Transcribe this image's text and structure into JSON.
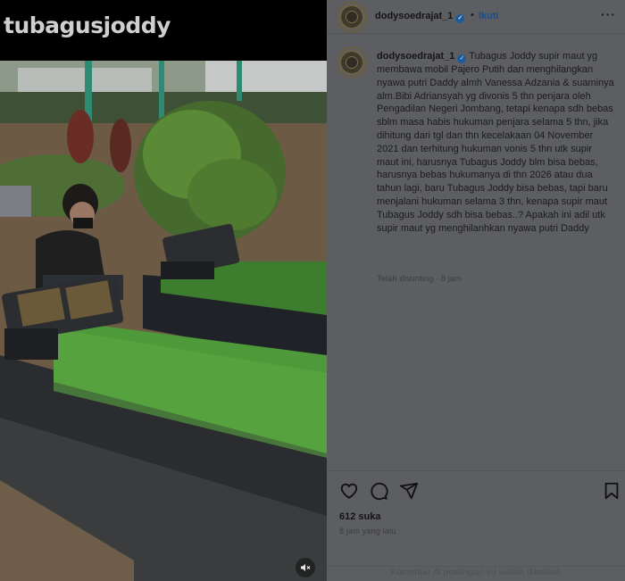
{
  "media": {
    "overlay_text": "tubagusjoddy",
    "mute_icon": "speaker-muted-icon"
  },
  "post": {
    "username": "dodysoedrajat_1",
    "verified_icon": "verified-badge-icon",
    "separator": "•",
    "follow_label": "Ikuti",
    "more_icon": "more-options-icon",
    "caption": "Tubagus Joddy supir maut yg membawa mobil Pajero Putih dan menghilangkan nyawa putri Daddy almh Vanessa Adzania & suaminya alm.Bibi Adriansyah yg divonis 5 thn penjara oleh Pengadilan Negeri Jombang, tetapi kenapa sdh bebas sblm masa habis hukuman penjara selama 5 thn, jika dihitung dari tgl dan thn kecelakaan 04 November 2021 dan terhitung hukuman vonis 5 thn utk supir maut ini, harusnya Tubagus Joddy blm bisa bebas, harusnya bebas hukumanya di thn 2026 atau dua tahun lagi, baru Tubagus Joddy bisa bebas, tapi baru menjalani hukuman selama 3 thn, kenapa supir maut Tubagus Joddy sdh bisa bebas..? Apakah ini adil utk supir maut yg menghilanhkan nyawa putri Daddy",
    "edited_meta": "Telah disunting · 8 jam",
    "likes": "612 suka",
    "time_ago": "8 jam yang lalu",
    "comments_limited": "Komentar di postingan ini sudah dibatasi."
  },
  "colors": {
    "panel_bg": "#5d5e61",
    "link_blue": "#1a4c86",
    "text": "#1b1b1b"
  }
}
